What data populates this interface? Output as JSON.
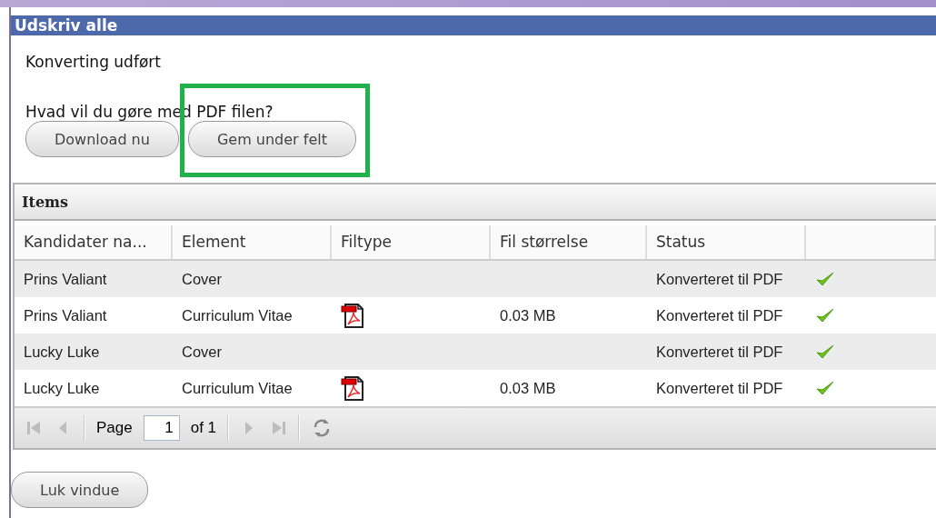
{
  "window": {
    "title": "Udskriv alle"
  },
  "message": "Konverting udført",
  "question": "Hvad vil du gøre med PDF filen?",
  "actions": [
    {
      "label": "Download nu",
      "highlighted": false
    },
    {
      "label": "Gem under felt",
      "highlighted": true
    }
  ],
  "grid": {
    "title": "Items",
    "columns": [
      "Kandidater na...",
      "Element",
      "Filtype",
      "Fil størrelse",
      "Status"
    ],
    "rows": [
      {
        "name": "Prins Valiant",
        "element": "Cover",
        "pdf": false,
        "size": "",
        "status": "Konverteret til PDF",
        "done": true
      },
      {
        "name": "Prins Valiant",
        "element": "Curriculum Vitae",
        "pdf": true,
        "size": "0.03 MB",
        "status": "Konverteret til PDF",
        "done": true
      },
      {
        "name": "Lucky Luke",
        "element": "Cover",
        "pdf": false,
        "size": "",
        "status": "Konverteret til PDF",
        "done": true
      },
      {
        "name": "Lucky Luke",
        "element": "Curriculum Vitae",
        "pdf": true,
        "size": "0.03 MB",
        "status": "Konverteret til PDF",
        "done": true
      }
    ],
    "pager": {
      "first_disabled": true,
      "prev_disabled": true,
      "label": "Page",
      "value": "1",
      "of": "of 1",
      "next_disabled": true,
      "last_disabled": true
    }
  },
  "close_button": "Luk vindue"
}
